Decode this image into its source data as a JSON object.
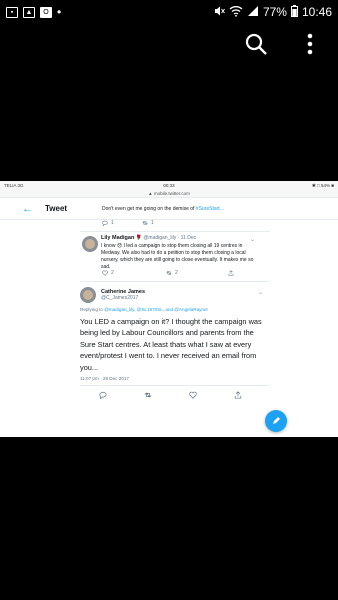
{
  "status_bar": {
    "carrier_icons": [
      "image-icon",
      "gallery-icon",
      "outlook-icon"
    ],
    "overflow": "•",
    "battery": "77%",
    "time": "10:46"
  },
  "gallery_bar": {
    "icons": [
      "search-icon",
      "more-vert-icon"
    ]
  },
  "screenshot": {
    "ipad_status": {
      "carrier": "TELIA 3G",
      "time": "00:33",
      "battery": "✱ □ 54% ■"
    },
    "url": "▲ mobile.twitter.com",
    "header": {
      "back_icon": "←",
      "title": "Tweet"
    },
    "cut_tweet": {
      "text": "Don't even get me going on the demise of ",
      "link": "#SureStart..."
    },
    "cut_actions": {
      "reply_count": "1",
      "retweet_count": "1"
    },
    "lily": {
      "name": "Lily Madigan",
      "emoji": "🌹",
      "handle": "@madigan_lily · 11 Dec",
      "text": "I know 😞 I led a campaign to stop them closing all 19 centres in Medway. We also had to do a petition to stop them closing a local nursery, which they are still going to close eventually. It makes me so sad.",
      "like_count": "2",
      "retweet_count": "2"
    },
    "catherine": {
      "name": "Catherine James",
      "handle": "@C_James2017",
      "replying_prefix": "Replying to",
      "replying_links": "@madigan_lily, @SL1970SL, and @AngelaRayner",
      "text": "You LED a campaign on it?  I thought the campaign was being led by Labour Councillors and parents from the Sure Start centres.  At least thats what I saw at every event/protest I went to.  I never received an email from you...",
      "timestamp": "11:07 pm · 28 Dec 2017"
    }
  }
}
